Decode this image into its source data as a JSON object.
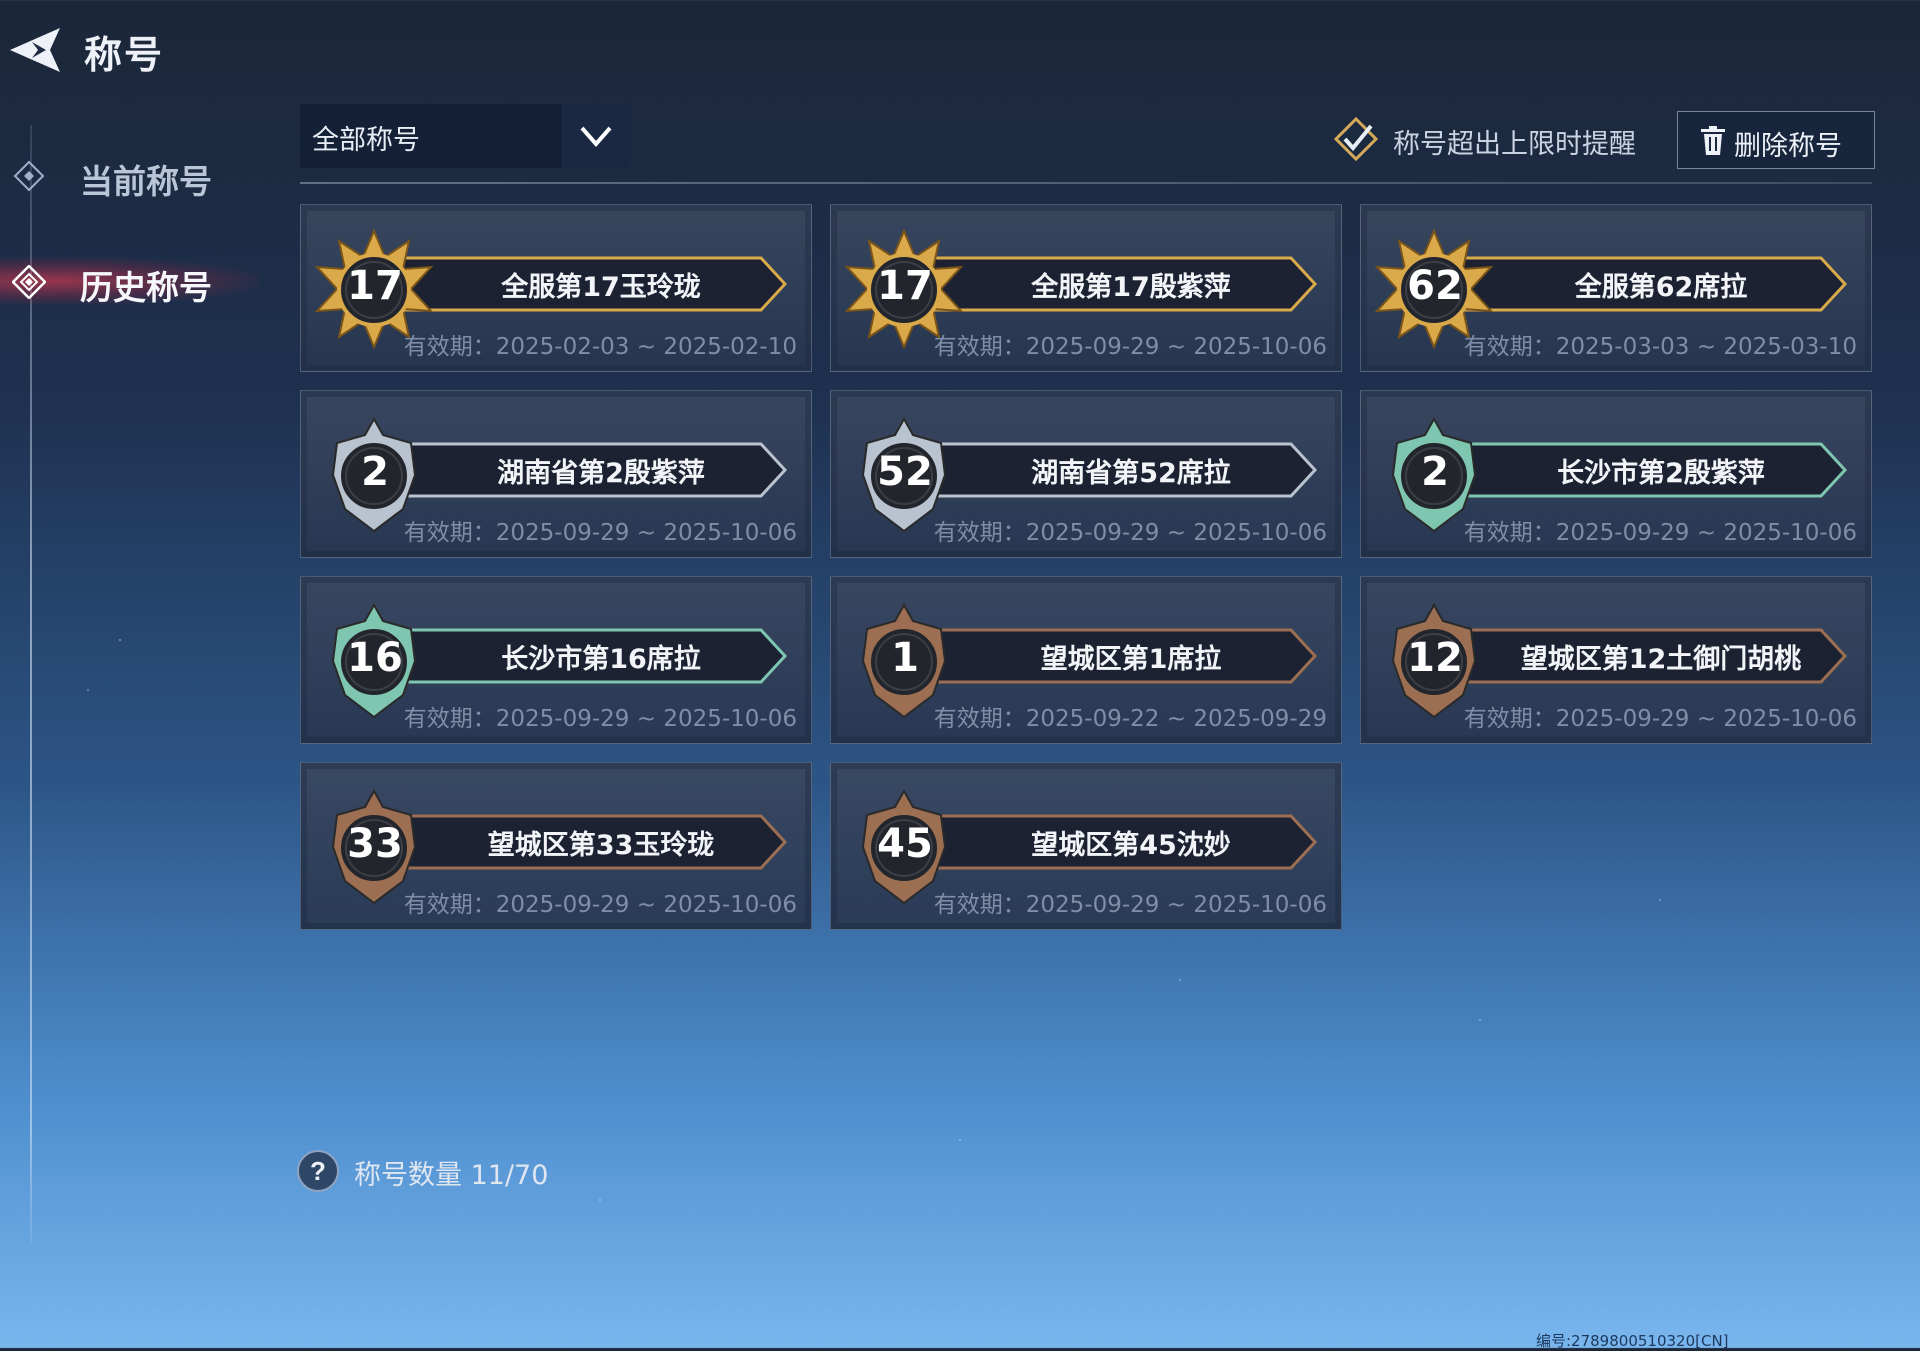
{
  "header": {
    "title": "称号"
  },
  "sidebar": {
    "items": [
      {
        "label": "当前称号",
        "active": false
      },
      {
        "label": "历史称号",
        "active": true
      }
    ]
  },
  "toolbar": {
    "filter": {
      "selected": "全部称号"
    },
    "reminder_label": "称号超出上限时提醒",
    "delete_label": "删除称号"
  },
  "titles": [
    {
      "rank": "17",
      "name": "全服第17玉玲珑",
      "validity": "有效期：2025-02-03 ~ 2025-02-10",
      "tier": "gold"
    },
    {
      "rank": "17",
      "name": "全服第17殷紫萍",
      "validity": "有效期：2025-09-29 ~ 2025-10-06",
      "tier": "gold"
    },
    {
      "rank": "62",
      "name": "全服第62席拉",
      "validity": "有效期：2025-03-03 ~ 2025-03-10",
      "tier": "gold"
    },
    {
      "rank": "2",
      "name": "湖南省第2殷紫萍",
      "validity": "有效期：2025-09-29 ~ 2025-10-06",
      "tier": "silver"
    },
    {
      "rank": "52",
      "name": "湖南省第52席拉",
      "validity": "有效期：2025-09-29 ~ 2025-10-06",
      "tier": "silver"
    },
    {
      "rank": "2",
      "name": "长沙市第2殷紫萍",
      "validity": "有效期：2025-09-29 ~ 2025-10-06",
      "tier": "jade"
    },
    {
      "rank": "16",
      "name": "长沙市第16席拉",
      "validity": "有效期：2025-09-29 ~ 2025-10-06",
      "tier": "jade"
    },
    {
      "rank": "1",
      "name": "望城区第1席拉",
      "validity": "有效期：2025-09-22 ~ 2025-09-29",
      "tier": "bronze"
    },
    {
      "rank": "12",
      "name": "望城区第12土御门胡桃",
      "validity": "有效期：2025-09-29 ~ 2025-10-06",
      "tier": "bronze"
    },
    {
      "rank": "33",
      "name": "望城区第33玉玲珑",
      "validity": "有效期：2025-09-29 ~ 2025-10-06",
      "tier": "bronze"
    },
    {
      "rank": "45",
      "name": "望城区第45沈妙",
      "validity": "有效期：2025-09-29 ~ 2025-10-06",
      "tier": "bronze"
    }
  ],
  "footer": {
    "count_label": "称号数量 11/70",
    "serial": "编号:2789800510320[CN]"
  },
  "colors": {
    "gold": "#d9a94a",
    "silver": "#b9c2cf",
    "jade": "#7fc6b0",
    "bronze": "#9c6e52",
    "active": "#ff4a5e"
  },
  "icons": {
    "back": "back-arrow-icon",
    "current": "diamond-icon",
    "history": "diamond-active-icon",
    "dropdown": "chevron-down-icon",
    "reminder": "checkmark-diamond-icon",
    "delete": "trash-icon",
    "help": "question-icon"
  }
}
